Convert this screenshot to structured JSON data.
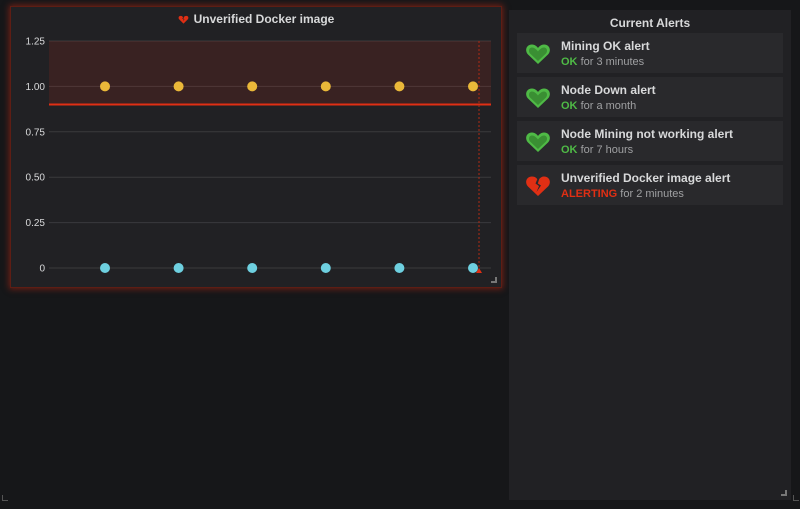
{
  "graph_panel": {
    "title": "Unverified Docker image",
    "state_color": "#e02f14",
    "icon": "broken-heart-icon"
  },
  "chart_data": {
    "type": "scatter",
    "title": "Unverified Docker image",
    "ylim": [
      0,
      1.25
    ],
    "yticks": [
      "1.25",
      "1.00",
      "0.75",
      "0.50",
      "0.25",
      "0"
    ],
    "ytick_values": [
      1.25,
      1.0,
      0.75,
      0.5,
      0.25,
      0
    ],
    "threshold": 0.9,
    "threshold_color": "#e02f14",
    "grid": true,
    "series": [
      {
        "color": "#eab839",
        "values": [
          1,
          1,
          1,
          1,
          1,
          1
        ]
      },
      {
        "color": "#6ed0e0",
        "values": [
          0,
          0,
          0,
          0,
          0,
          0
        ]
      }
    ]
  },
  "alerts_panel": {
    "title": "Current Alerts",
    "items": [
      {
        "name": "Mining OK alert",
        "state": "OK",
        "duration": "for 3 minutes",
        "icon": "heart-icon",
        "color": "#4fba46"
      },
      {
        "name": "Node Down alert",
        "state": "OK",
        "duration": "for a month",
        "icon": "heart-icon",
        "color": "#4fba46"
      },
      {
        "name": "Node Mining not working alert",
        "state": "OK",
        "duration": "for 7 hours",
        "icon": "heart-icon",
        "color": "#4fba46"
      },
      {
        "name": "Unverified Docker image alert",
        "state": "ALERTING",
        "duration": "for 2 minutes",
        "icon": "broken-heart-icon",
        "color": "#e02f14"
      }
    ]
  }
}
